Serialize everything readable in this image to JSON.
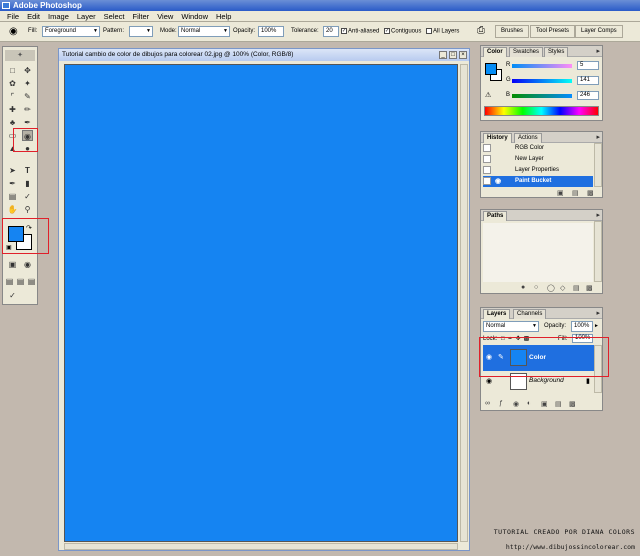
{
  "app_title": "Adobe Photoshop",
  "menu": [
    "File",
    "Edit",
    "Image",
    "Layer",
    "Select",
    "Filter",
    "View",
    "Window",
    "Help"
  ],
  "options": {
    "fill_label": "Fill:",
    "fill_value": "Foreground",
    "pattern_label": "Pattern:",
    "mode_label": "Mode:",
    "mode_value": "Normal",
    "opacity_label": "Opacity:",
    "opacity_value": "100%",
    "tolerance_label": "Tolerance:",
    "tolerance_value": "20",
    "antialiased": "Anti-aliased",
    "contiguous": "Contiguous",
    "all_layers": "All Layers",
    "palette_well": [
      "Brushes",
      "Tool Presets",
      "Layer Comps"
    ]
  },
  "document": {
    "title": "Tutorial cambio de color de dibujos para colorear 02.jpg @ 100% (Color, RGB/8)",
    "canvas_color": "#1584f2"
  },
  "color_panel": {
    "tabs": [
      "Color",
      "Swatches",
      "Styles"
    ],
    "r_label": "R",
    "g_label": "G",
    "b_label": "B",
    "r": "5",
    "g": "141",
    "b": "246",
    "fg": "#058df6"
  },
  "history_panel": {
    "tabs": [
      "History",
      "Actions"
    ],
    "items": [
      "RGB Color",
      "New Layer",
      "Layer Properties",
      "Paint Bucket"
    ]
  },
  "paths_panel": {
    "tabs": [
      "Paths"
    ]
  },
  "layers_panel": {
    "tabs": [
      "Layers",
      "Channels"
    ],
    "blend_mode": "Normal",
    "opacity_label": "Opacity:",
    "opacity": "100%",
    "lock_label": "Lock:",
    "fill_label": "Fill:",
    "fill": "100%",
    "layers": [
      {
        "name": "Color",
        "color": "#1584f2"
      },
      {
        "name": "Background"
      }
    ]
  },
  "credit": {
    "line1": "TUTORIAL CREADO POR DIANA COLORS",
    "line2": "http://www.dibujossincolorear.com"
  },
  "accent": "#e0202a"
}
